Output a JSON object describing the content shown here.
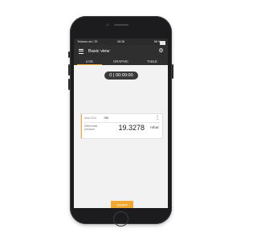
{
  "status_bar": {
    "carrier": "Telekom.de LTE",
    "time": "08:28",
    "battery": "88 %",
    "battery_level": 0.88
  },
  "app_bar": {
    "title": "Basic view",
    "menu_icon": "hamburger-menu-icon",
    "settings_icon": "gear-icon"
  },
  "tabs": [
    {
      "label": "LIVE",
      "active": true
    },
    {
      "label": "GRAPHIC"
    },
    {
      "label": "TABLE"
    }
  ],
  "timer": {
    "value": "0 | 00:00:00"
  },
  "card": {
    "probe_label": "testo 510i",
    "probe_value": "780",
    "measurement_label_line1": "Differential",
    "measurement_label_line2": "pressure",
    "value": "19.3278",
    "unit": "mbar",
    "menu_icon": "kebab-menu-icon"
  },
  "start_button": {
    "label": "START"
  },
  "colors": {
    "accent": "#f0a830",
    "appbar": "#2f2f2f"
  }
}
